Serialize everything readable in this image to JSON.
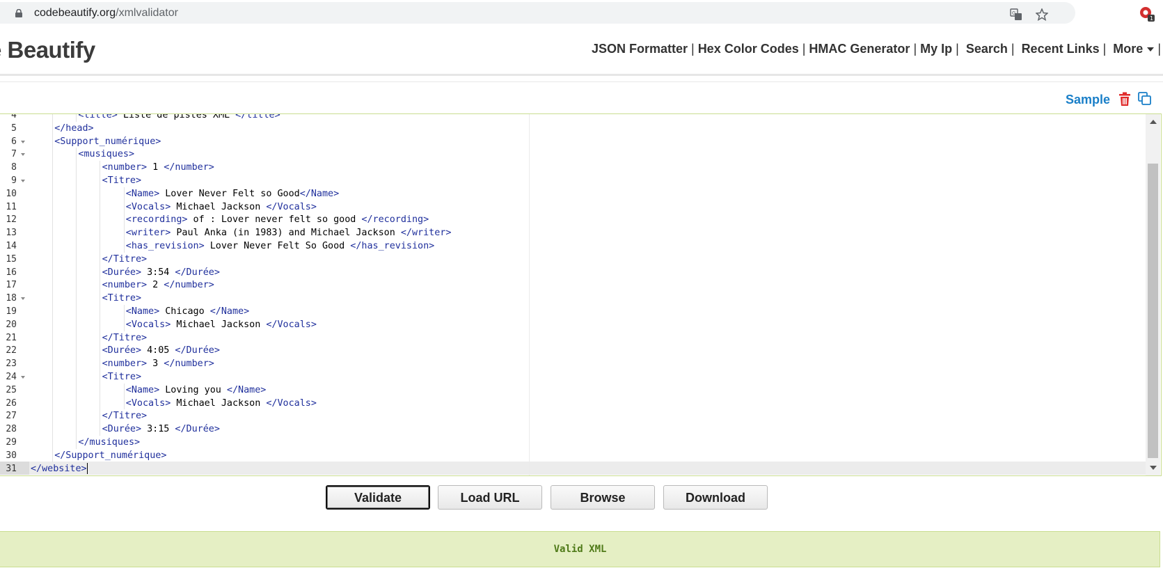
{
  "browser": {
    "url_domain": "codebeautify.org",
    "url_path": "/xmlvalidator",
    "extension_badge": "1"
  },
  "header": {
    "logo_text": "e Beautify",
    "nav": [
      "JSON Formatter",
      "Hex Color Codes",
      "HMAC Generator",
      "My Ip",
      "Search",
      "Recent Links",
      "More"
    ]
  },
  "toolbar": {
    "sample_label": "Sample"
  },
  "editor": {
    "lines": [
      {
        "num": "4",
        "indent": 2,
        "fold": false,
        "text": "<title> Liste de pistes XML </title>"
      },
      {
        "num": "5",
        "indent": 1,
        "fold": false,
        "text": "</head>"
      },
      {
        "num": "6",
        "indent": 1,
        "fold": true,
        "text": "<Support_numérique>"
      },
      {
        "num": "7",
        "indent": 2,
        "fold": true,
        "text": "<musiques>"
      },
      {
        "num": "8",
        "indent": 3,
        "fold": false,
        "text": "<number> 1 </number>"
      },
      {
        "num": "9",
        "indent": 3,
        "fold": true,
        "text": "<Titre>"
      },
      {
        "num": "10",
        "indent": 4,
        "fold": false,
        "text": "<Name> Lover Never Felt so Good</Name>"
      },
      {
        "num": "11",
        "indent": 4,
        "fold": false,
        "text": "<Vocals> Michael Jackson </Vocals>"
      },
      {
        "num": "12",
        "indent": 4,
        "fold": false,
        "text": "<recording> of : Lover never felt so good </recording>"
      },
      {
        "num": "13",
        "indent": 4,
        "fold": false,
        "text": "<writer> Paul Anka (in 1983) and Michael Jackson </writer>"
      },
      {
        "num": "14",
        "indent": 4,
        "fold": false,
        "text": "<has_revision> Lover Never Felt So Good </has_revision>"
      },
      {
        "num": "15",
        "indent": 3,
        "fold": false,
        "text": "</Titre>"
      },
      {
        "num": "16",
        "indent": 3,
        "fold": false,
        "text": "<Durée> 3:54 </Durée>"
      },
      {
        "num": "17",
        "indent": 3,
        "fold": false,
        "text": "<number> 2 </number>"
      },
      {
        "num": "18",
        "indent": 3,
        "fold": true,
        "text": "<Titre>"
      },
      {
        "num": "19",
        "indent": 4,
        "fold": false,
        "text": "<Name> Chicago </Name>"
      },
      {
        "num": "20",
        "indent": 4,
        "fold": false,
        "text": "<Vocals> Michael Jackson </Vocals>"
      },
      {
        "num": "21",
        "indent": 3,
        "fold": false,
        "text": "</Titre>"
      },
      {
        "num": "22",
        "indent": 3,
        "fold": false,
        "text": "<Durée> 4:05 </Durée>"
      },
      {
        "num": "23",
        "indent": 3,
        "fold": false,
        "text": "<number> 3 </number>"
      },
      {
        "num": "24",
        "indent": 3,
        "fold": true,
        "text": "<Titre>"
      },
      {
        "num": "25",
        "indent": 4,
        "fold": false,
        "text": "<Name> Loving you </Name>"
      },
      {
        "num": "26",
        "indent": 4,
        "fold": false,
        "text": "<Vocals> Michael Jackson </Vocals>"
      },
      {
        "num": "27",
        "indent": 3,
        "fold": false,
        "text": "</Titre>"
      },
      {
        "num": "28",
        "indent": 3,
        "fold": false,
        "text": "<Durée> 3:15 </Durée>"
      },
      {
        "num": "29",
        "indent": 2,
        "fold": false,
        "text": "</musiques>"
      },
      {
        "num": "30",
        "indent": 1,
        "fold": false,
        "text": "</Support_numérique>"
      },
      {
        "num": "31",
        "indent": 0,
        "fold": false,
        "text": "</website>"
      }
    ]
  },
  "buttons": {
    "validate": "Validate",
    "load_url": "Load URL",
    "browse": "Browse",
    "download": "Download"
  },
  "result": {
    "message": "Valid XML"
  },
  "colors": {
    "tag": "#1f2f9c",
    "result_bg": "#e5efc4",
    "result_text": "#4f7a18",
    "accent": "#1a7fc8"
  }
}
